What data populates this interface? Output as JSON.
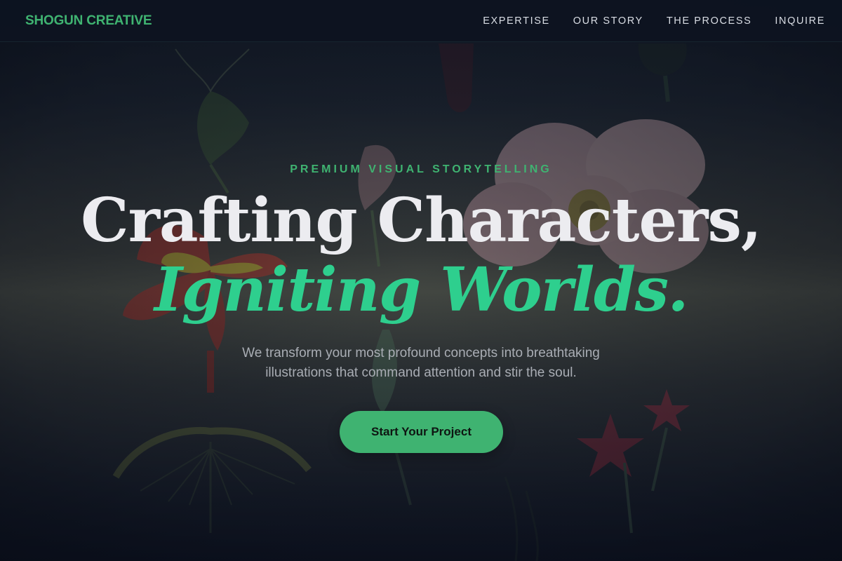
{
  "brand": {
    "name": "SHOGUN CREATIVE",
    "color": "#3fb371"
  },
  "nav": {
    "items": [
      {
        "label": "EXPERTISE"
      },
      {
        "label": "OUR STORY"
      },
      {
        "label": "THE PROCESS"
      },
      {
        "label": "INQUIRE"
      }
    ]
  },
  "hero": {
    "eyebrow": "PREMIUM VISUAL STORYTELLING",
    "headline_line1": "Crafting Characters,",
    "headline_line2": "Igniting Worlds.",
    "subtext": "We transform your most profound concepts into breathtaking illustrations that command attention and stir the soul.",
    "cta_label": "Start Your Project",
    "background": "botanical-flower-illustrations"
  },
  "colors": {
    "accent": "#3fb371",
    "headline_accent": "#2ecf8e",
    "headline": "#ececf0",
    "navbar_bg": "#0d1321"
  }
}
